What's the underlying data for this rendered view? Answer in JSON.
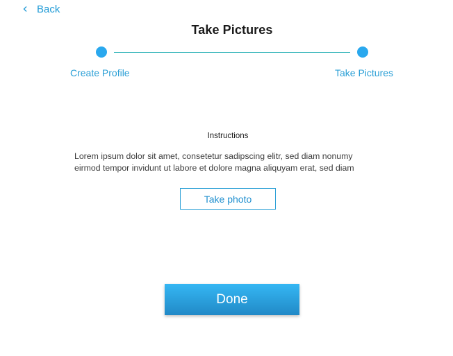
{
  "header": {
    "back_label": "Back",
    "title": "Take Pictures"
  },
  "stepper": {
    "steps": [
      {
        "label": "Create Profile"
      },
      {
        "label": "Take Pictures"
      }
    ]
  },
  "instructions": {
    "title": "Instructions",
    "lines": [
      "Lorem ipsum dolor sit amet, consetetur sadipscing elitr, sed diam nonumy",
      "eirmod tempor invidunt ut labore et dolore magna aliquyam erat, sed diam"
    ]
  },
  "actions": {
    "take_photo_label": "Take photo",
    "done_label": "Done"
  },
  "colors": {
    "accent": "#2aa8ee",
    "link": "#1f9ad6",
    "connector": "#2fb3b8",
    "done_gradient_top": "#35b7f4",
    "done_gradient_bottom": "#2189c7"
  },
  "icons": {
    "back": "chevron-left-icon"
  }
}
